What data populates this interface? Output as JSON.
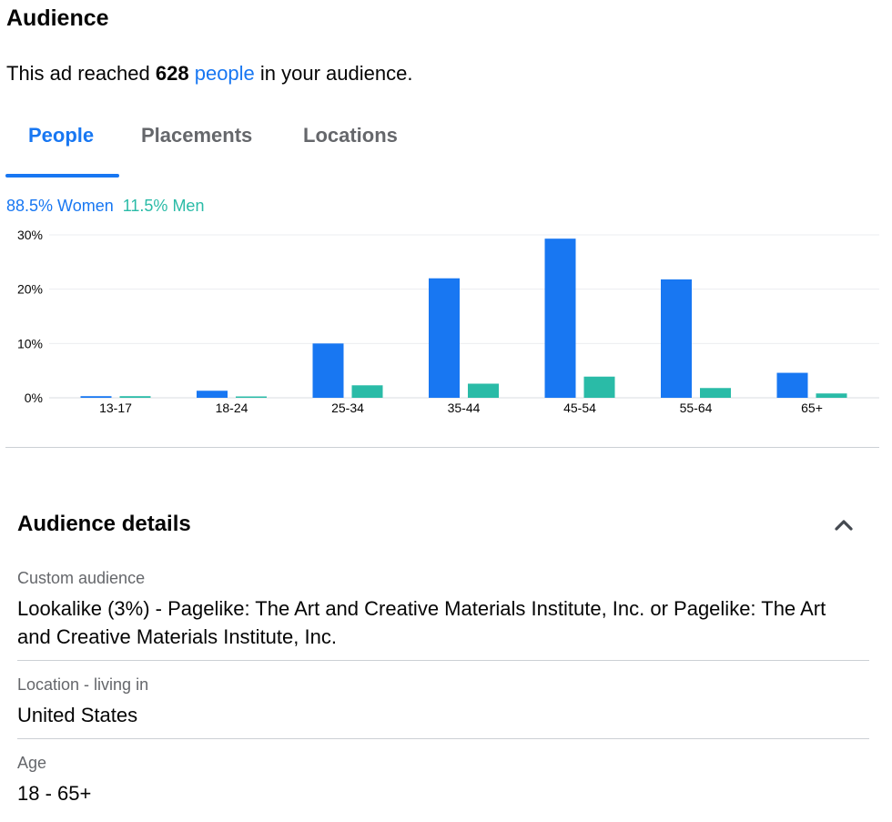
{
  "header": {
    "title": "Audience",
    "summary_prefix": "This ad reached ",
    "reach_count": "628",
    "people_link": "people",
    "summary_suffix": " in your audience."
  },
  "tabs": [
    {
      "label": "People",
      "active": true
    },
    {
      "label": "Placements",
      "active": false
    },
    {
      "label": "Locations",
      "active": false
    }
  ],
  "gender_split": {
    "women": "88.5% Women",
    "men": "11.5% Men"
  },
  "colors": {
    "accent": "#1877f2",
    "women": "#1877f2",
    "men": "#2abba7",
    "divider": "#ccd0d5",
    "muted_text": "#65676b"
  },
  "chart_data": {
    "type": "bar",
    "categories": [
      "13-17",
      "18-24",
      "25-34",
      "35-44",
      "45-54",
      "55-64",
      "65+"
    ],
    "series": [
      {
        "name": "Women",
        "values": [
          0.3,
          1.3,
          10.0,
          22.0,
          29.3,
          21.8,
          4.6
        ]
      },
      {
        "name": "Men",
        "values": [
          0.3,
          0.2,
          2.3,
          2.6,
          3.9,
          1.8,
          0.8
        ]
      }
    ],
    "yticks": [
      "0%",
      "10%",
      "20%",
      "30%"
    ],
    "ylim": [
      0,
      30
    ],
    "grid": true,
    "title": "",
    "xlabel": "",
    "ylabel": ""
  },
  "details": {
    "title": "Audience details",
    "toggle_icon": "chevron-up-icon",
    "items": [
      {
        "label": "Custom audience",
        "value": "Lookalike (3%) - Pagelike: The Art and Creative Materials Institute, Inc. or Pagelike: The Art and Creative Materials Institute, Inc."
      },
      {
        "label": "Location - living in",
        "value": "United States"
      },
      {
        "label": "Age",
        "value": "18 - 65+"
      }
    ]
  }
}
